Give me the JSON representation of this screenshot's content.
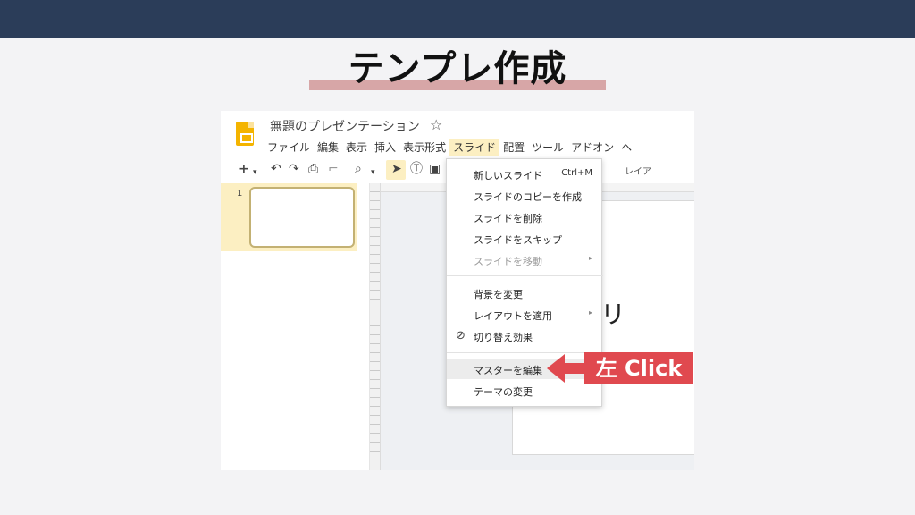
{
  "heading": "テンプレ作成",
  "app": {
    "doc_title": "無題のプレゼンテーション",
    "star_icon": "☆",
    "menu": [
      "ファイル",
      "編集",
      "表示",
      "挿入",
      "表示形式",
      "スライド",
      "配置",
      "ツール",
      "アドオン",
      "ヘ"
    ],
    "active_menu_index": 5,
    "toolbar_tail": "レイア"
  },
  "filmstrip": {
    "slide_number": "1"
  },
  "slide_text": "リ",
  "dropdown": {
    "items": [
      {
        "label": "新しいスライド",
        "shortcut": "Ctrl+M"
      },
      {
        "label": "スライドのコピーを作成"
      },
      {
        "label": "スライドを削除"
      },
      {
        "label": "スライドをスキップ"
      },
      {
        "label": "スライドを移動",
        "disabled": true,
        "submenu_arrow": "▸"
      },
      {
        "label": "背景を変更"
      },
      {
        "label": "レイアウトを適用",
        "submenu_arrow": "▸"
      },
      {
        "label": "切り替え効果",
        "icon": "transition-icon"
      },
      {
        "label": "マスターを編集",
        "hover": true
      },
      {
        "label": "テーマの変更"
      }
    ]
  },
  "callout": {
    "text": "左 Click",
    "color": "#e0494f"
  },
  "colors": {
    "top_band": "#2b3d59",
    "highlight": "#fcefc2",
    "underline": "#d7a6a7"
  }
}
